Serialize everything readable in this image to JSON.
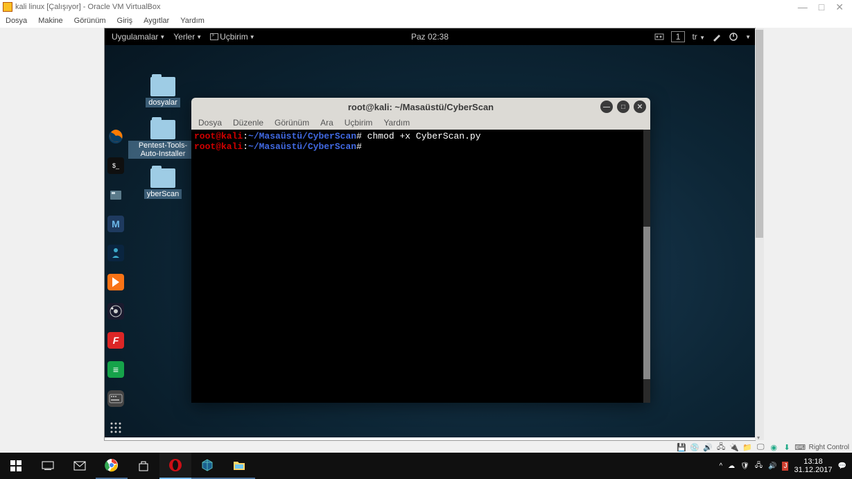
{
  "host_window": {
    "title": "kali linux [Çalışıyor] - Oracle VM VirtualBox",
    "menu": [
      "Dosya",
      "Makine",
      "Görünüm",
      "Giriş",
      "Aygıtlar",
      "Yardım"
    ]
  },
  "kali": {
    "topbar": {
      "apps": "Uygulamalar",
      "places": "Yerler",
      "terminal": "Uçbirim",
      "clock": "Paz 02:38",
      "lang": "tr",
      "workspace": "1"
    },
    "folders": [
      {
        "label": "dosyalar"
      },
      {
        "label": "Pentest-Tools-Auto-Installer"
      },
      {
        "label": "yberScan"
      }
    ]
  },
  "terminal": {
    "title": "root@kali: ~/Masaüstü/CyberScan",
    "menu": [
      "Dosya",
      "Düzenle",
      "Görünüm",
      "Ara",
      "Uçbirim",
      "Yardım"
    ],
    "lines": [
      {
        "user": "root@kali",
        "path": "~/Masaüstü/CyberScan",
        "prompt": "#",
        "cmd": " chmod +x CyberScan.py"
      },
      {
        "user": "root@kali",
        "path": "~/Masaüstü/CyberScan",
        "prompt": "#",
        "cmd": ""
      }
    ]
  },
  "vb_status": {
    "key": "Right Control"
  },
  "win": {
    "time": "13:18",
    "date": "31.12.2017"
  }
}
